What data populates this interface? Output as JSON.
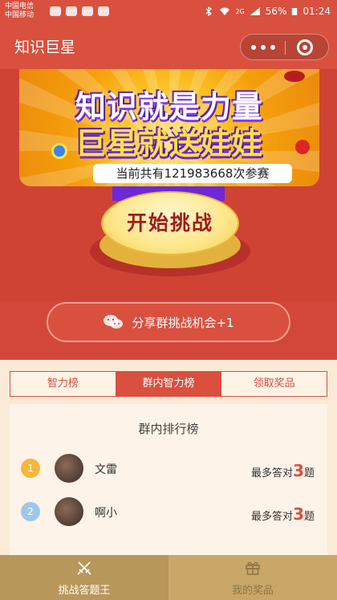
{
  "status_bar": {
    "carrier_1": "中国电信",
    "carrier_2": "中国移动",
    "network_type": "2G",
    "battery": "56%",
    "time": "01:24"
  },
  "header": {
    "title": "知识巨星"
  },
  "banner": {
    "line1": "知识就是力量",
    "line2": "巨星就送娃娃",
    "participants_text": "当前共有121983668次参赛"
  },
  "start_button": {
    "label": "开始挑战"
  },
  "share_button": {
    "label": "分享群挑战机会+1"
  },
  "tabs": [
    {
      "label": "智力榜",
      "active": false
    },
    {
      "label": "群内智力榜",
      "active": true
    },
    {
      "label": "领取奖品",
      "active": false
    }
  ],
  "ranking": {
    "title": "群内排行榜",
    "rows": [
      {
        "rank": "1",
        "name": "文雷",
        "score_prefix": "最多答对",
        "score": "3",
        "score_suffix": "题",
        "badge_color": "#f6b73c"
      },
      {
        "rank": "2",
        "name": "啊小",
        "score_prefix": "最多答对",
        "score": "3",
        "score_suffix": "题",
        "badge_color": "#9fc7ee"
      }
    ]
  },
  "bottom_nav": [
    {
      "label": "挑战答题王",
      "icon": "crossed-swords-icon",
      "active": true
    },
    {
      "label": "我的奖品",
      "icon": "gift-icon",
      "active": false
    }
  ],
  "colors": {
    "primary": "#d9503f",
    "nav_bg": "#c9a768",
    "highlight": "#d9503f"
  }
}
